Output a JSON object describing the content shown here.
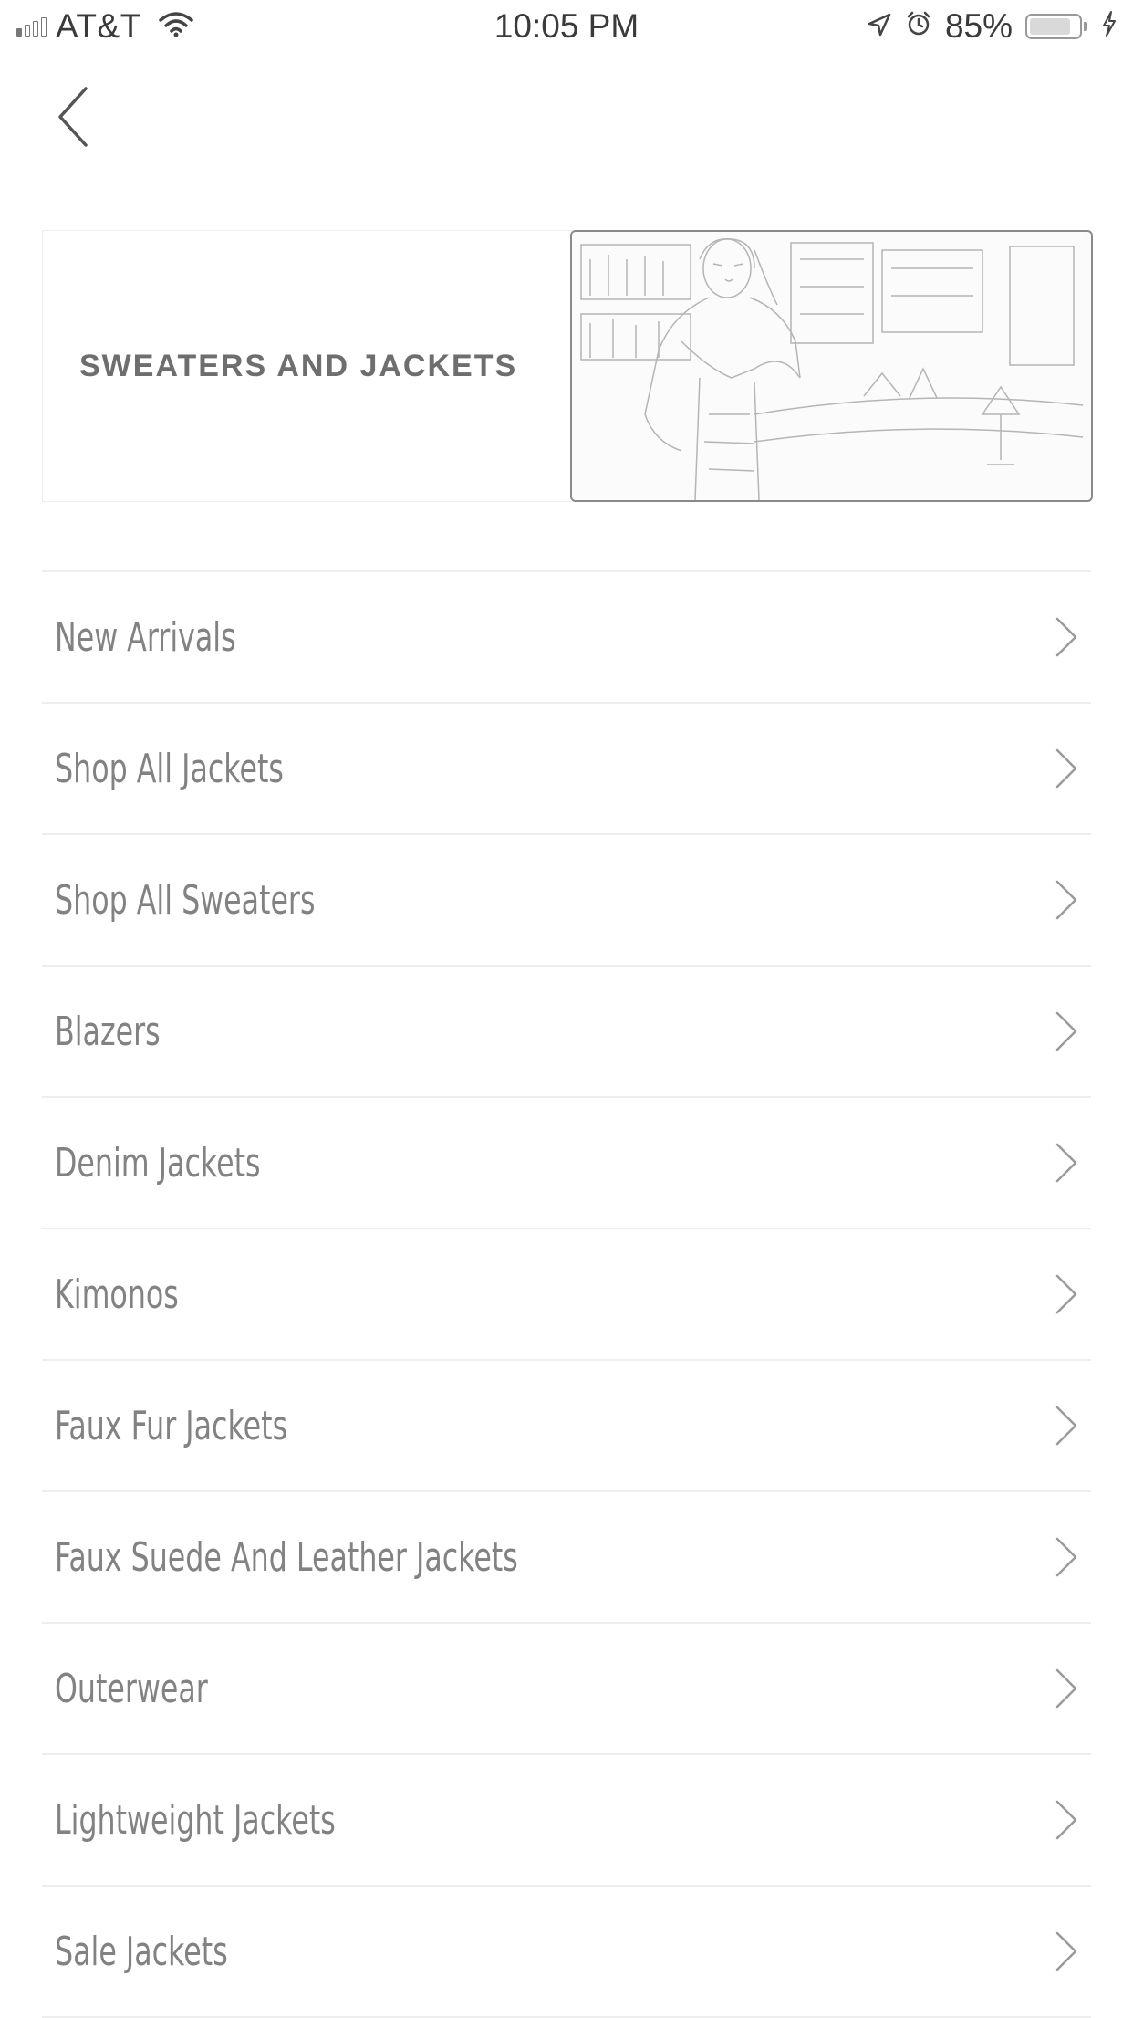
{
  "status_bar": {
    "carrier": "AT&T",
    "time": "10:05 PM",
    "battery_percent": "85%",
    "battery_level": 0.85,
    "icons": [
      "signal-icon",
      "wifi-icon",
      "location-icon",
      "alarm-icon",
      "battery-icon",
      "charging-icon"
    ]
  },
  "nav": {
    "back_icon": "chevron-left-icon"
  },
  "banner": {
    "title": "SWEATERS AND JACKETS",
    "image_subject": "model-in-jacket-photo"
  },
  "menu": {
    "items": [
      {
        "label": "New Arrivals"
      },
      {
        "label": "Shop All Jackets"
      },
      {
        "label": "Shop All Sweaters"
      },
      {
        "label": "Blazers"
      },
      {
        "label": "Denim Jackets"
      },
      {
        "label": "Kimonos"
      },
      {
        "label": "Faux Fur Jackets"
      },
      {
        "label": "Faux Suede And Leather Jackets"
      },
      {
        "label": "Outerwear"
      },
      {
        "label": "Lightweight Jackets"
      },
      {
        "label": "Sale Jackets"
      }
    ],
    "item_icon": "chevron-right-icon"
  },
  "colors": {
    "text": "#828282",
    "divider": "#eeeeee",
    "background": "#ffffff"
  }
}
